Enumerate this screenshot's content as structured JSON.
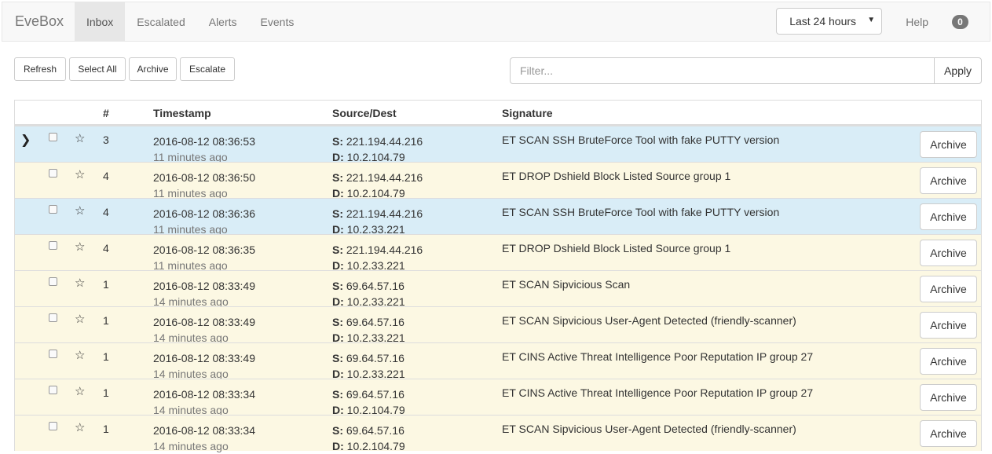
{
  "nav": {
    "brand": "EveBox",
    "items": [
      "Inbox",
      "Escalated",
      "Alerts",
      "Events"
    ],
    "active": 0,
    "time_range": "Last 24 hours",
    "help": "Help",
    "badge": "0"
  },
  "toolbar": {
    "refresh": "Refresh",
    "select_all": "Select All",
    "archive": "Archive",
    "escalate": "Escalate",
    "filter_placeholder": "Filter...",
    "apply": "Apply"
  },
  "table": {
    "headers": {
      "count": "#",
      "timestamp": "Timestamp",
      "source_dest": "Source/Dest",
      "signature": "Signature"
    },
    "src_label": "S:",
    "dst_label": "D:",
    "archive_label": "Archive",
    "rows": [
      {
        "style": "info",
        "expanded": true,
        "count": "3",
        "timestamp": "2016-08-12 08:36:53",
        "ago": "11 minutes ago",
        "src": "221.194.44.216",
        "dst": "10.2.104.79",
        "signature": "ET SCAN SSH BruteForce Tool with fake PUTTY version"
      },
      {
        "style": "warn",
        "expanded": false,
        "count": "4",
        "timestamp": "2016-08-12 08:36:50",
        "ago": "11 minutes ago",
        "src": "221.194.44.216",
        "dst": "10.2.104.79",
        "signature": "ET DROP Dshield Block Listed Source group 1"
      },
      {
        "style": "info",
        "expanded": false,
        "count": "4",
        "timestamp": "2016-08-12 08:36:36",
        "ago": "11 minutes ago",
        "src": "221.194.44.216",
        "dst": "10.2.33.221",
        "signature": "ET SCAN SSH BruteForce Tool with fake PUTTY version"
      },
      {
        "style": "warn",
        "expanded": false,
        "count": "4",
        "timestamp": "2016-08-12 08:36:35",
        "ago": "11 minutes ago",
        "src": "221.194.44.216",
        "dst": "10.2.33.221",
        "signature": "ET DROP Dshield Block Listed Source group 1"
      },
      {
        "style": "warn",
        "expanded": false,
        "count": "1",
        "timestamp": "2016-08-12 08:33:49",
        "ago": "14 minutes ago",
        "src": "69.64.57.16",
        "dst": "10.2.33.221",
        "signature": "ET SCAN Sipvicious Scan"
      },
      {
        "style": "warn",
        "expanded": false,
        "count": "1",
        "timestamp": "2016-08-12 08:33:49",
        "ago": "14 minutes ago",
        "src": "69.64.57.16",
        "dst": "10.2.33.221",
        "signature": "ET SCAN Sipvicious User-Agent Detected (friendly-scanner)"
      },
      {
        "style": "warn",
        "expanded": false,
        "count": "1",
        "timestamp": "2016-08-12 08:33:49",
        "ago": "14 minutes ago",
        "src": "69.64.57.16",
        "dst": "10.2.33.221",
        "signature": "ET CINS Active Threat Intelligence Poor Reputation IP group 27"
      },
      {
        "style": "warn",
        "expanded": false,
        "count": "1",
        "timestamp": "2016-08-12 08:33:34",
        "ago": "14 minutes ago",
        "src": "69.64.57.16",
        "dst": "10.2.104.79",
        "signature": "ET CINS Active Threat Intelligence Poor Reputation IP group 27"
      },
      {
        "style": "warn",
        "expanded": false,
        "count": "1",
        "timestamp": "2016-08-12 08:33:34",
        "ago": "14 minutes ago",
        "src": "69.64.57.16",
        "dst": "10.2.104.79",
        "signature": "ET SCAN Sipvicious User-Agent Detected (friendly-scanner)"
      }
    ]
  },
  "icons": {
    "expander": "chevron-right-icon",
    "star": "star-outline-icon",
    "dropdown": "caret-down-icon"
  },
  "colors": {
    "info_row": "#d9edf7",
    "warn_row": "#fcf8e3",
    "badge": "#777777"
  }
}
